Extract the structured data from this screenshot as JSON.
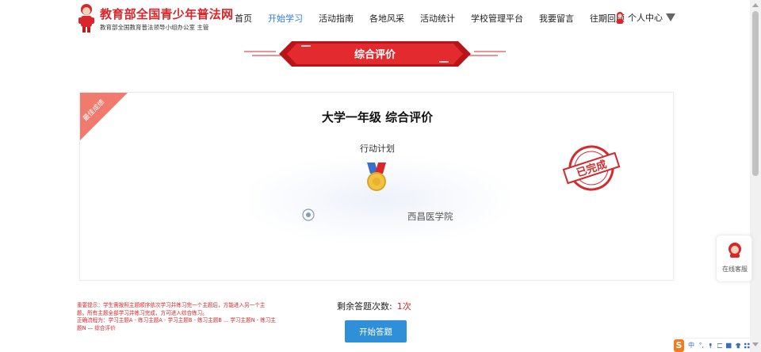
{
  "header": {
    "logo_title": "教育部全国青少年普法网",
    "logo_subtitle": "教育部全国教育普法领导小组办公室 主管",
    "nav_items": [
      "首页",
      "开始学习",
      "活动指南",
      "各地风采",
      "活动统计",
      "学校管理平台",
      "我要留言",
      "往期回顾"
    ],
    "active_nav": "开始学习",
    "user_center_label": "个人中心"
  },
  "banner": {
    "title": "综合评价"
  },
  "card": {
    "ribbon_text": "最佳成绩",
    "title": "大学一年级 综合评价",
    "subtitle": "行动计划",
    "school_name": "西昌医学院",
    "stamp_text": "已完成"
  },
  "bottom": {
    "notice_lines": [
      "重要提示：学生需按照主题顺序依次学习并练习完一个主题后，方能进入另一个主",
      "题。所有主题全部学习并练习完成，方可进入综合练习。",
      "正确流程为：学习主题A - 练习主题A - 学习主题B - 练习主题B ... 学习主题N - 练习主",
      "题N — 综合评价"
    ],
    "remain_label": "剩余答题次数:",
    "remain_count": "1次",
    "start_button": "开始答题"
  },
  "service": {
    "label": "在线客服"
  },
  "ime": {
    "logo": "S",
    "items": [
      "中",
      "°,"
    ]
  },
  "colors": {
    "brand_red": "#d8262b",
    "nav_active_blue": "#2d7cd6",
    "button_blue": "#2f8fd9"
  }
}
